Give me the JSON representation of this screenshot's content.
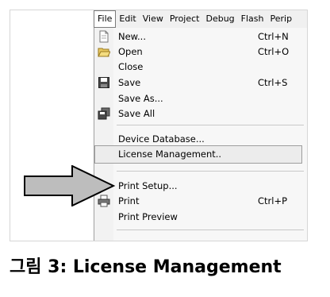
{
  "menubar": {
    "items": [
      "File",
      "Edit",
      "View",
      "Project",
      "Debug",
      "Flash",
      "Perip"
    ]
  },
  "file_menu": {
    "new": {
      "label": "New...",
      "shortcut": "Ctrl+N",
      "icon": "new-file-icon"
    },
    "open": {
      "label": "Open",
      "shortcut": "Ctrl+O",
      "icon": "open-folder-icon"
    },
    "close": {
      "label": "Close"
    },
    "save": {
      "label": "Save",
      "shortcut": "Ctrl+S",
      "icon": "save-disk-icon"
    },
    "save_as": {
      "label": "Save As..."
    },
    "save_all": {
      "label": "Save All",
      "icon": "save-all-icon"
    },
    "device_database": {
      "label": "Device Database..."
    },
    "license_management": {
      "label": "License Management.."
    },
    "print_setup": {
      "label": "Print Setup..."
    },
    "print": {
      "label": "Print",
      "shortcut": "Ctrl+P",
      "icon": "printer-icon"
    },
    "print_preview": {
      "label": "Print Preview"
    }
  },
  "caption": "그림 3: License Management",
  "colors": {
    "arrow_fill": "#bdbdbd",
    "highlight_bg": "#ececec"
  }
}
